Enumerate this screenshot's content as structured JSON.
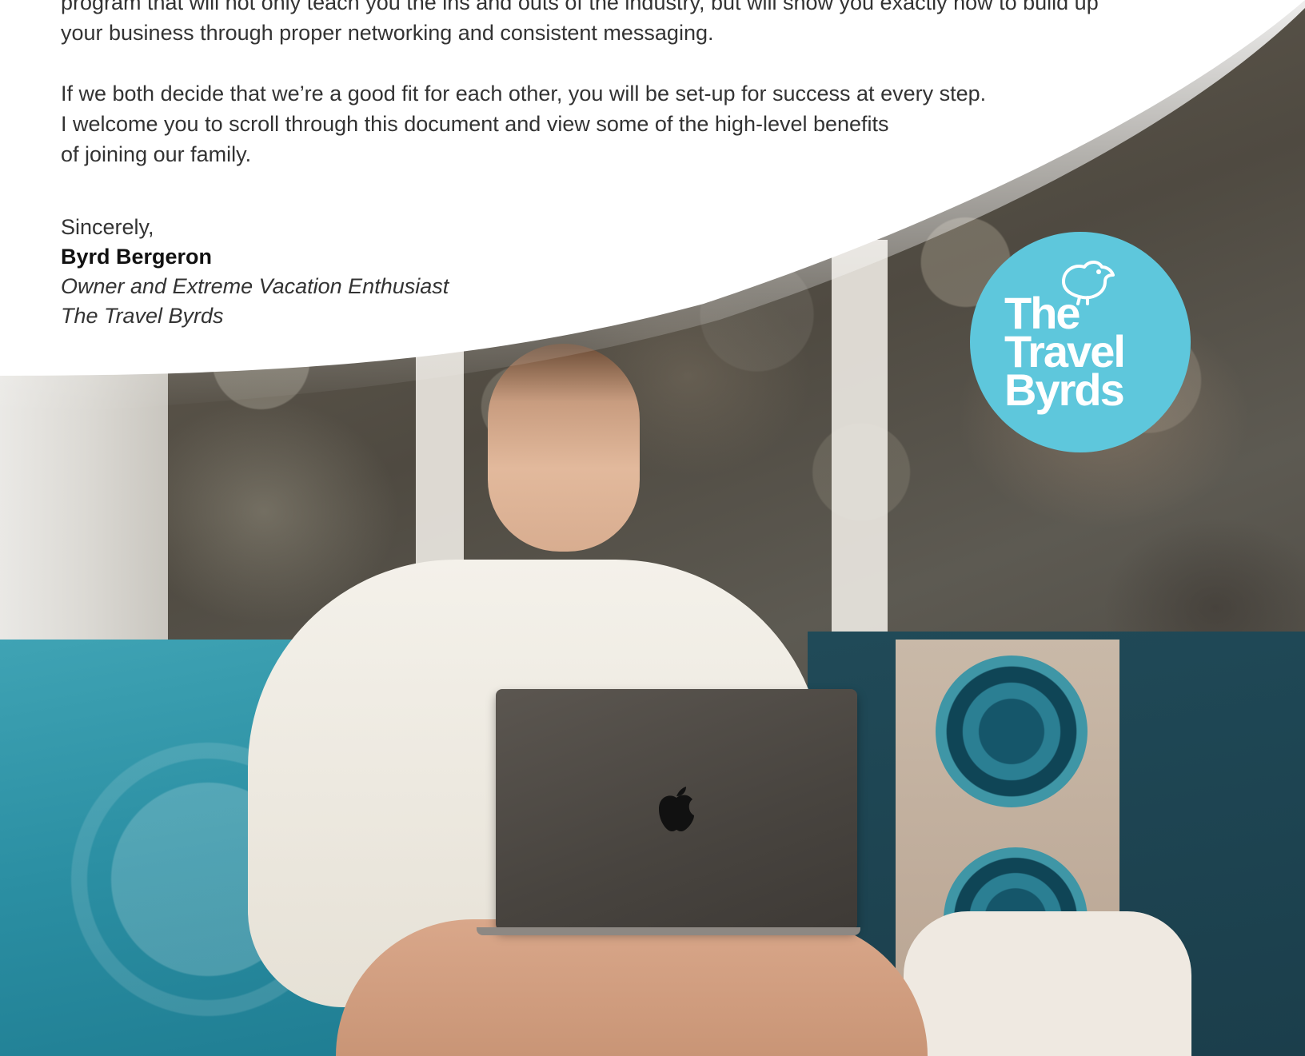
{
  "letter": {
    "paragraph1": [
      "program that will not only teach you the ins and outs of the industry, but will show you exactly how to build up",
      "your business through proper networking and consistent messaging."
    ],
    "paragraph2": [
      "If we both decide that we’re a good fit for each other, you will be set-up for success at every step.",
      "I welcome you to scroll through this document and view some of the high-level benefits",
      "of joining our family."
    ],
    "signoff": {
      "greeting": "Sincerely,",
      "name": "Byrd Bergeron",
      "title": "Owner and Extreme Vacation Enthusiast",
      "company": "The Travel Byrds"
    }
  },
  "logo": {
    "line1": "The",
    "line2": "Travel",
    "line3": "Byrds",
    "background_color": "#5ec7dc",
    "icon": "bird-icon"
  },
  "photo": {
    "laptop_icon": "apple-logo-icon"
  }
}
